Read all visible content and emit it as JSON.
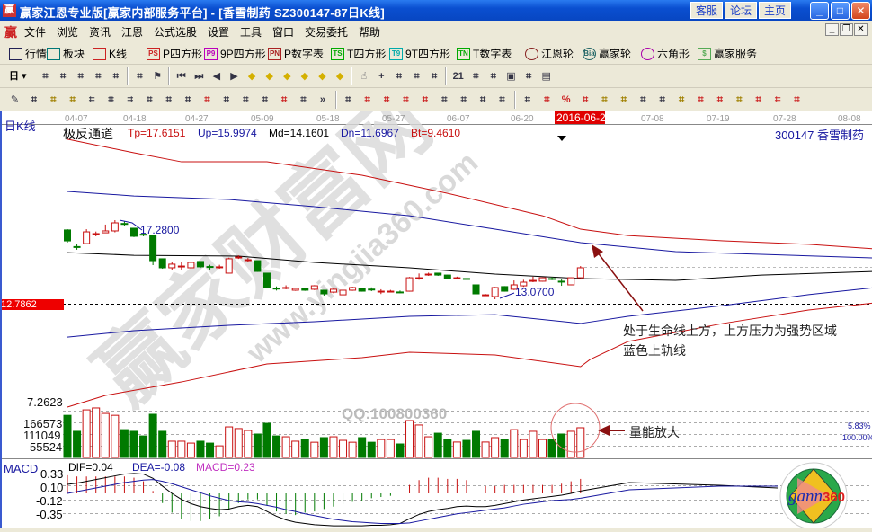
{
  "window": {
    "title": "赢家江恩专业版[赢家内部服务平台] - [香雪制药   SZ300147-87日K线]",
    "links": [
      "客服",
      "论坛",
      "主页"
    ],
    "controls": [
      "minimize",
      "maximize",
      "close"
    ]
  },
  "menu": {
    "items": [
      "文件",
      "浏览",
      "资讯",
      "江恩",
      "公式选股",
      "设置",
      "工具",
      "窗口",
      "交易委托",
      "帮助"
    ]
  },
  "toolbar1": {
    "items": [
      {
        "label": "行情",
        "icon": "quote-table-icon"
      },
      {
        "label": "板块",
        "icon": "sector-blocks-icon"
      },
      {
        "label": "K线",
        "icon": "candlestick-icon"
      },
      {
        "label": "P四方形",
        "icon": "ps-icon",
        "glyph": "PS"
      },
      {
        "label": "9P四方形",
        "icon": "p9-icon",
        "glyph": "P9"
      },
      {
        "label": "P数字表",
        "icon": "pn-icon",
        "glyph": "PN"
      },
      {
        "label": "T四方形",
        "icon": "ts-icon",
        "glyph": "TS"
      },
      {
        "label": "9T四方形",
        "icon": "t9-icon",
        "glyph": "T9"
      },
      {
        "label": "T数字表",
        "icon": "tn-icon",
        "glyph": "TN"
      },
      {
        "label": "江恩轮",
        "icon": "gann-wheel-icon"
      },
      {
        "label": "赢家轮",
        "icon": "winner-wheel-icon",
        "glyph": "Bia"
      },
      {
        "label": "六角形",
        "icon": "hexagon-icon"
      },
      {
        "label": "赢家服务",
        "icon": "dollar-icon",
        "glyph": "$"
      }
    ]
  },
  "toolbar2": {
    "period": "日",
    "icons": [
      "chart-overlay-icon",
      "notes-icon",
      "bars-3-icon",
      "bars-9-icon",
      "candle-dropdown-icon",
      "map-icon",
      "flag-icon",
      "first-bar-icon",
      "last-bar-icon",
      "scroll-left-icon",
      "scroll-right-icon",
      "pan-left-icon",
      "pan-right-icon",
      "zoom-horizontal-icon",
      "shrink-icon",
      "zoom-in-icon",
      "zoom-out-icon",
      "hand-icon",
      "crosshair-icon",
      "line-draw-icon",
      "festival-icon",
      "cycle-line-icon",
      "calendar-icon",
      "calculator-icon",
      "report-icon",
      "save-icon",
      "network-icon",
      "print-icon"
    ]
  },
  "toolbar3": {
    "icons": [
      "pencil-icon",
      "grid-lines-icon",
      "gold-lines-icon",
      "gold-lines-2-icon",
      "fib-lines-icon",
      "spiral-icon",
      "eraser-icon",
      "circle-grid-icon",
      "parallel-lines-icon",
      "n2-lines-icon",
      "triangle-icon",
      "target-icon",
      "star-icon",
      "square-grid-icon",
      "angle-lines-icon",
      "god-lines-icon",
      "more-icon",
      "box-icon",
      "fan-lines-icon",
      "gann-box-icon",
      "gann-box-2-icon",
      "angle-fan-icon",
      "zigzag-icon",
      "grid-icon",
      "grid-2-icon",
      "parallel-slant-icon",
      "price-scale-icon",
      "percent-line-icon",
      "percent-icon",
      "percent-list-icon",
      "gold-coin-icon",
      "gold-list-icon",
      "brush-icon",
      "wave-icon",
      "gold-icon",
      "j-fan-icon",
      "f-fan-icon",
      "gold-fan-icon",
      "shen-fan-icon",
      "ying-fan-icon",
      "si-fan-icon"
    ]
  },
  "chart": {
    "period_label": "日K线",
    "indicator_name": "极反通道",
    "params": [
      {
        "text": "Tp=17.6151",
        "color": "#c81010"
      },
      {
        "text": "Up=15.9974",
        "color": "#1818a0"
      },
      {
        "text": "Md=14.1601",
        "color": "#000000"
      },
      {
        "text": "Dn=11.6967",
        "color": "#1818a0"
      },
      {
        "text": "Bt=9.4610",
        "color": "#c81010"
      }
    ],
    "stock": "300147 香雪制药",
    "dates": [
      "04-07",
      "04-18",
      "04-27",
      "05-09",
      "05-18",
      "05-27",
      "06-07",
      "06-20",
      "2016-06-28",
      "07-08",
      "07-19",
      "07-28",
      "08-08"
    ],
    "selected_date": "2016-06-28",
    "current_price_label": "12.7862",
    "high_label": "17.2800",
    "low_label": "13.0700",
    "annotation_1": "处于生命线上方，上方压力为强势区域",
    "annotation_2": "蓝色上轨线",
    "annotation_volume": "量能放大",
    "watermark": "赢家财富网",
    "watermark_url": "www.yingjia360.com",
    "watermark_qq": "QQ:100800360",
    "colors": {
      "up": "#c81010",
      "down": "#007a00",
      "upper_band": "#c81010",
      "mid": "#000000",
      "lower_band": "#1818a0"
    }
  },
  "chart_data": {
    "type": "candlestick",
    "ohlc": [
      [
        17.45,
        16.76,
        17.5,
        16.65
      ],
      [
        16.4,
        16.37,
        16.55,
        16.2
      ],
      [
        16.59,
        17.33,
        17.5,
        16.54
      ],
      [
        17.2,
        17.22,
        17.35,
        17.05
      ],
      [
        17.27,
        17.39,
        17.79,
        17.27
      ],
      [
        17.39,
        17.9,
        18.07,
        17.3
      ],
      [
        17.86,
        17.84,
        18.0,
        17.7
      ],
      [
        17.56,
        17.05,
        17.56,
        17.0
      ],
      [
        17.18,
        17.16,
        17.28,
        17.05
      ],
      [
        17.1,
        15.51,
        17.1,
        15.23
      ],
      [
        15.63,
        15.06,
        15.63,
        15.0
      ],
      [
        15.06,
        15.29,
        15.4,
        14.89
      ],
      [
        15.15,
        15.17,
        15.4,
        14.95
      ],
      [
        15.06,
        15.4,
        15.45,
        15.0
      ],
      [
        15.46,
        15.12,
        15.46,
        15.05
      ],
      [
        15.14,
        15.12,
        15.25,
        14.95
      ],
      [
        15.1,
        15.12,
        15.25,
        15.0
      ],
      [
        14.72,
        15.63,
        15.7,
        14.7
      ],
      [
        15.72,
        15.74,
        15.85,
        15.62
      ],
      [
        15.55,
        15.57,
        15.68,
        15.45
      ],
      [
        15.51,
        14.83,
        15.51,
        14.8
      ],
      [
        14.72,
        13.81,
        14.72,
        13.75
      ],
      [
        13.77,
        13.75,
        13.88,
        13.62
      ],
      [
        13.79,
        13.81,
        13.95,
        13.7
      ],
      [
        13.64,
        13.75,
        13.8,
        13.6
      ],
      [
        13.75,
        13.64,
        13.78,
        13.6
      ],
      [
        13.7,
        13.92,
        13.96,
        13.65
      ],
      [
        13.64,
        13.41,
        13.66,
        13.3
      ],
      [
        13.52,
        13.7,
        13.75,
        13.45
      ],
      [
        13.35,
        13.64,
        13.68,
        13.32
      ],
      [
        13.64,
        13.81,
        13.86,
        13.6
      ],
      [
        13.75,
        13.58,
        13.78,
        13.55
      ],
      [
        13.71,
        13.7,
        13.82,
        13.58
      ],
      [
        13.56,
        13.58,
        13.7,
        13.4
      ],
      [
        13.56,
        13.58,
        13.66,
        13.5
      ],
      [
        13.53,
        13.52,
        13.62,
        13.45
      ],
      [
        13.58,
        14.43,
        14.48,
        13.55
      ],
      [
        14.42,
        14.43,
        14.7,
        14.3
      ],
      [
        14.64,
        14.66,
        14.75,
        14.55
      ],
      [
        14.72,
        14.6,
        14.72,
        14.55
      ],
      [
        14.6,
        14.38,
        14.62,
        14.35
      ],
      [
        14.42,
        14.43,
        14.5,
        14.4
      ],
      [
        14.38,
        14.37,
        14.4,
        14.36
      ],
      [
        13.98,
        13.41,
        14.0,
        13.38
      ],
      [
        13.34,
        13.35,
        13.4,
        13.3
      ],
      [
        13.24,
        13.81,
        13.85,
        13.07
      ],
      [
        13.87,
        13.58,
        13.9,
        13.55
      ],
      [
        13.7,
        13.98,
        14.26,
        13.65
      ],
      [
        13.92,
        14.15,
        14.3,
        13.85
      ],
      [
        14.25,
        14.26,
        14.5,
        14.15
      ],
      [
        14.21,
        14.43,
        14.45,
        14.18
      ],
      [
        14.38,
        14.37,
        14.48,
        14.28
      ],
      [
        14.21,
        14.2,
        14.35,
        13.92
      ],
      [
        13.98,
        14.43,
        14.45,
        13.95
      ],
      [
        14.43,
        15.06,
        15.17,
        14.4
      ]
    ],
    "volume": [
      200000,
      124000,
      226000,
      235000,
      209000,
      200000,
      132000,
      124000,
      102000,
      205000,
      124000,
      77000,
      77000,
      68000,
      77000,
      68000,
      55000,
      145000,
      137000,
      128000,
      111000,
      162000,
      102000,
      98000,
      77000,
      85000,
      72000,
      94000,
      98000,
      81000,
      72000,
      94000,
      72000,
      85000,
      85000,
      64000,
      175000,
      154000,
      98000,
      115000,
      85000,
      73000,
      81000,
      124000,
      73000,
      94000,
      85000,
      132000,
      85000,
      124000,
      85000,
      85000,
      111000,
      124000,
      141000
    ],
    "volume_axis": [
      "166573",
      "111049",
      "55524"
    ],
    "price_axis_low": "7.2623",
    "volume_pct": [
      "5.83%",
      "100.00%"
    ],
    "bands": {
      "Tp": [
        [
          1,
          23.19
        ],
        [
          8,
          22.33
        ],
        [
          13,
          21.76
        ],
        [
          22,
          21.76
        ],
        [
          32,
          20.91
        ],
        [
          41,
          19.77
        ],
        [
          51,
          18.35
        ],
        [
          55,
          17.5
        ],
        [
          60,
          17.1
        ],
        [
          70,
          16.76
        ],
        [
          79,
          16.54
        ],
        [
          86,
          16.25
        ]
      ],
      "Up": [
        [
          1,
          19.89
        ],
        [
          8,
          19.6
        ],
        [
          18,
          19.38
        ],
        [
          27,
          18.92
        ],
        [
          37,
          18.35
        ],
        [
          46,
          17.5
        ],
        [
          55,
          16.65
        ],
        [
          65,
          16.08
        ],
        [
          74,
          15.91
        ],
        [
          86,
          15.68
        ]
      ],
      "Md": [
        [
          1,
          16.02
        ],
        [
          8,
          15.85
        ],
        [
          19,
          15.8
        ],
        [
          27,
          15.4
        ],
        [
          37,
          15.06
        ],
        [
          46,
          14.66
        ],
        [
          55,
          14.38
        ],
        [
          65,
          14.26
        ],
        [
          74,
          14.6
        ],
        [
          86,
          14.83
        ]
      ],
      "Dn": [
        [
          1,
          10.68
        ],
        [
          8,
          11.08
        ],
        [
          18,
          11.42
        ],
        [
          27,
          11.65
        ],
        [
          37,
          11.99
        ],
        [
          46,
          12.1
        ],
        [
          55,
          11.54
        ],
        [
          60,
          11.99
        ],
        [
          70,
          12.67
        ],
        [
          79,
          13.36
        ],
        [
          86,
          13.81
        ]
      ],
      "Bt": [
        [
          1,
          6.25
        ],
        [
          5,
          6.99
        ],
        [
          13,
          7.84
        ],
        [
          22,
          8.98
        ],
        [
          32,
          9.38
        ],
        [
          37,
          9.72
        ],
        [
          46,
          9.55
        ],
        [
          55,
          8.81
        ],
        [
          56,
          9.26
        ],
        [
          60,
          10.4
        ],
        [
          70,
          11.54
        ],
        [
          79,
          12.39
        ],
        [
          86,
          12.84
        ]
      ]
    },
    "macd": {
      "label": "MACD",
      "dif_label": "DIF=0.04",
      "dea_label": "DEA=-0.08",
      "macd_label": "MACD=0.23",
      "axis": [
        "0.33",
        "0.10",
        "-0.12",
        "-0.35"
      ],
      "dif": [
        0.15,
        0.17,
        0.2,
        0.23,
        0.26,
        0.29,
        0.32,
        0.33,
        0.32,
        0.25,
        0.12,
        0.0,
        -0.1,
        -0.17,
        -0.22,
        -0.25,
        -0.27,
        -0.26,
        -0.22,
        -0.2,
        -0.22,
        -0.3,
        -0.38,
        -0.44,
        -0.48,
        -0.5,
        -0.52,
        -0.53,
        -0.54,
        -0.54,
        -0.54,
        -0.54,
        -0.53,
        -0.53,
        -0.52,
        -0.5,
        -0.42,
        -0.35,
        -0.3,
        -0.27,
        -0.25,
        -0.22,
        -0.21,
        -0.22,
        -0.22,
        -0.2,
        -0.17,
        -0.14,
        -0.11,
        -0.09,
        -0.07,
        -0.05,
        -0.03,
        0.0,
        0.04
      ],
      "dea": [
        0.0,
        0.03,
        0.06,
        0.09,
        0.12,
        0.15,
        0.18,
        0.2,
        0.22,
        0.23,
        0.2,
        0.16,
        0.11,
        0.06,
        0.01,
        -0.04,
        -0.08,
        -0.12,
        -0.14,
        -0.15,
        -0.17,
        -0.2,
        -0.23,
        -0.27,
        -0.3,
        -0.34,
        -0.37,
        -0.4,
        -0.43,
        -0.45,
        -0.47,
        -0.48,
        -0.49,
        -0.5,
        -0.5,
        -0.5,
        -0.49,
        -0.46,
        -0.43,
        -0.4,
        -0.37,
        -0.34,
        -0.32,
        -0.3,
        -0.28,
        -0.26,
        -0.24,
        -0.21,
        -0.18,
        -0.16,
        -0.14,
        -0.12,
        -0.11,
        -0.1,
        -0.08
      ]
    }
  },
  "logo": {
    "text": "gann360"
  }
}
